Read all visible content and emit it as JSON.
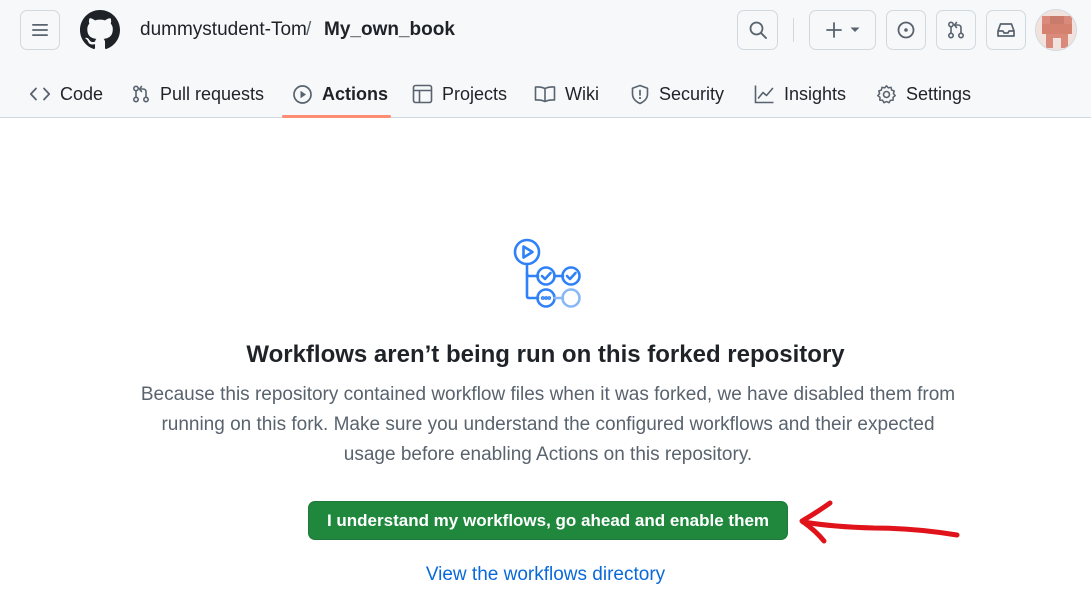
{
  "header": {
    "owner": "dummystudent-Tom",
    "separator": "/",
    "repo": "My_own_book"
  },
  "tabs": [
    {
      "label": "Code",
      "icon": "code-icon"
    },
    {
      "label": "Pull requests",
      "icon": "git-pull-request-icon"
    },
    {
      "label": "Actions",
      "icon": "play-icon",
      "active": true
    },
    {
      "label": "Projects",
      "icon": "table-icon"
    },
    {
      "label": "Wiki",
      "icon": "book-icon"
    },
    {
      "label": "Security",
      "icon": "shield-icon"
    },
    {
      "label": "Insights",
      "icon": "graph-icon"
    },
    {
      "label": "Settings",
      "icon": "gear-icon"
    }
  ],
  "main": {
    "title": "Workflows aren’t being run on this forked repository",
    "description_lines": [
      "Because this repository contained workflow files when it was forked, we have disabled them from",
      "running on this fork. Make sure you understand the configured workflows and their expected",
      "usage before enabling Actions on this repository."
    ],
    "enable_button": "I understand my workflows, go ahead and enable them",
    "view_link": "View the workflows directory"
  },
  "colors": {
    "accent_underline": "#fd8c73",
    "primary_button": "#1f883d",
    "link": "#0969da",
    "workflow_icon": "#2f81f7",
    "annotation_arrow": "#e0131a"
  }
}
